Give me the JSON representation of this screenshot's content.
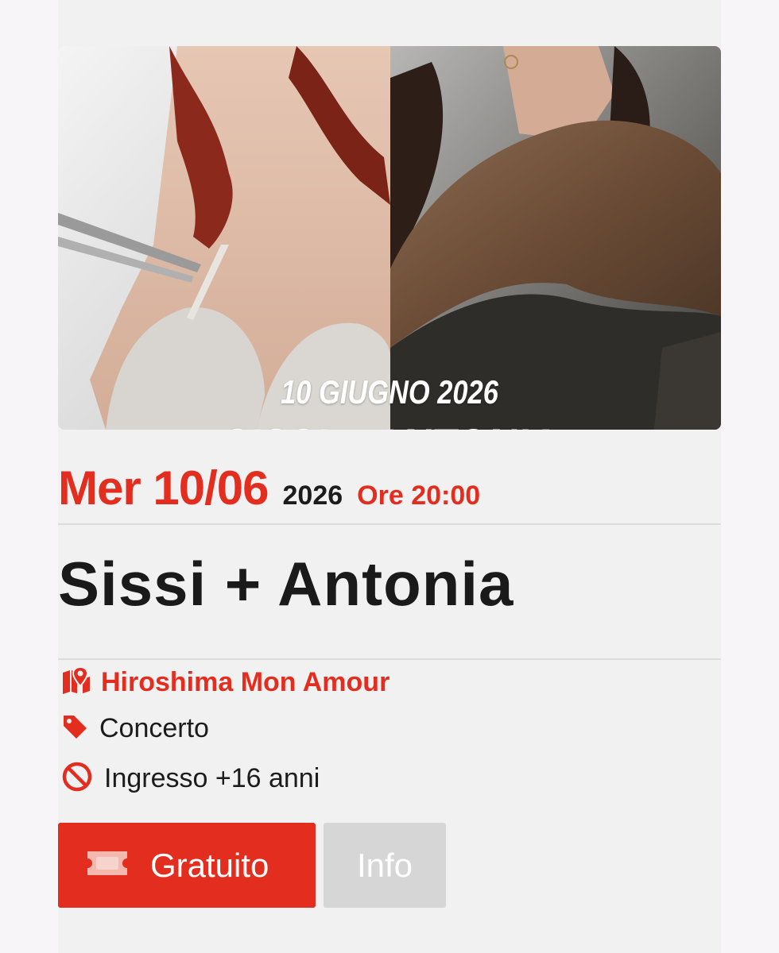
{
  "event_image": {
    "date_text": "10 GIUGNO 2026",
    "title_text": "SISSI + ANTONIA"
  },
  "date": {
    "day": "Mer 10/06",
    "year": "2026",
    "time": "Ore 20:00"
  },
  "title": "Sissi + Antonia",
  "details": {
    "venue": "Hiroshima Mon Amour",
    "category": "Concerto",
    "age_restriction": "Ingresso +16 anni"
  },
  "icons": {
    "venue": "map-marker-icon",
    "category": "tag-icon",
    "age_restriction": "ban-icon",
    "ticket": "ticket-icon"
  },
  "buttons": {
    "ticket_label": "Gratuito",
    "info_label": "Info"
  },
  "colors": {
    "accent": "#e22d1f",
    "text": "#1c1c1c",
    "card_background": "#f2f1f1",
    "info_button": "#d6d6d6"
  }
}
